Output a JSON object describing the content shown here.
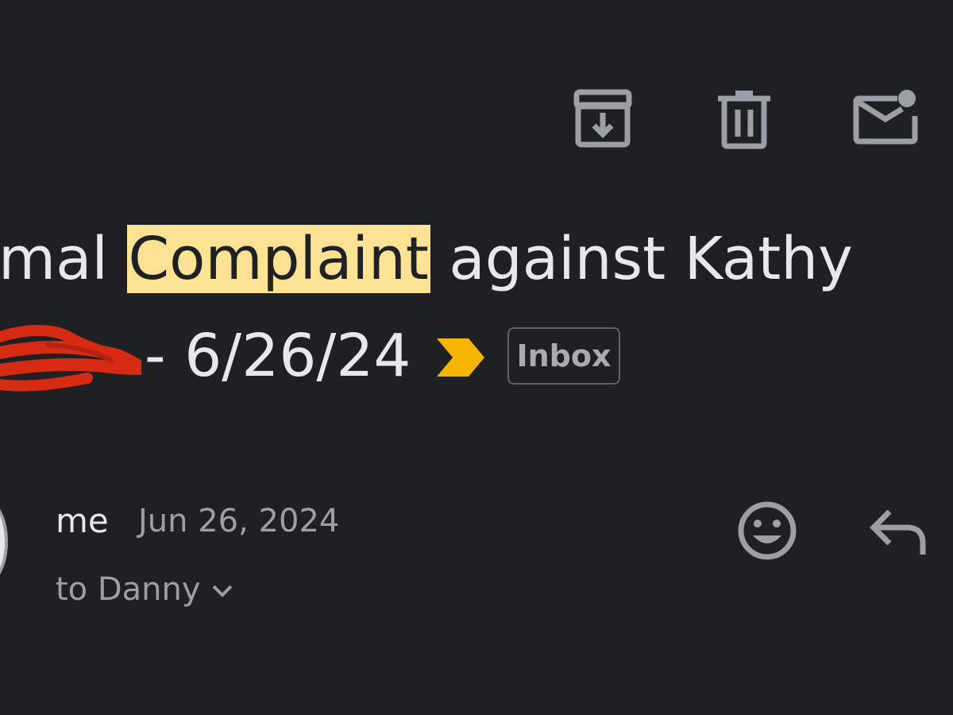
{
  "toolbar": {
    "archive_icon": "archive-icon",
    "delete_icon": "delete-icon",
    "mark_unread_icon": "mark-unread-icon",
    "icon_color": "#9aa0a6"
  },
  "subject": {
    "line1_prefix": "mal ",
    "line1_highlight": "Complaint",
    "line1_suffix": " against Kathy",
    "line2_text": "- 6/26/24",
    "highlight_color": "#fde293",
    "importance_color": "#f5b400",
    "label": "Inbox"
  },
  "message": {
    "sender": "me",
    "date": "Jun 26, 2024",
    "recipient": "to Danny",
    "emoji_icon": "add-reaction-icon",
    "reply_icon": "reply-icon"
  }
}
